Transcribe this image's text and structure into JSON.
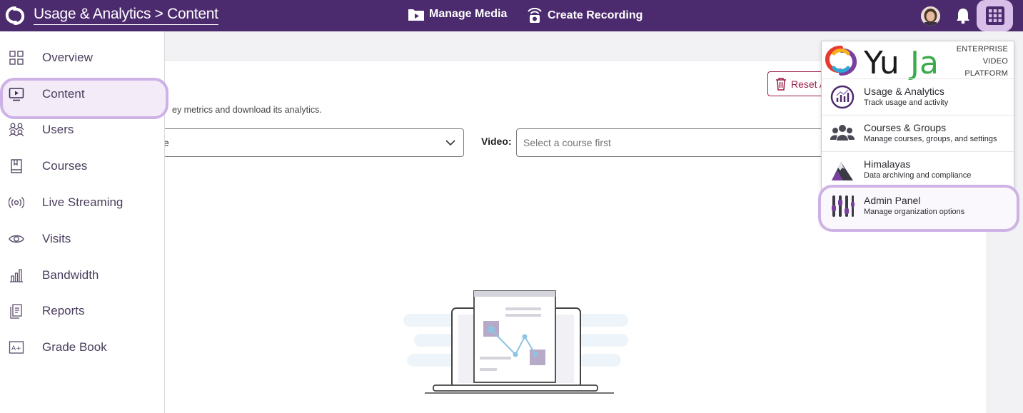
{
  "header": {
    "breadcrumb": "Usage & Analytics > Content",
    "manage_media": "Manage Media",
    "create_recording": "Create Recording",
    "icons": [
      "yuja-logo-icon",
      "media-folder-icon",
      "camera-icon",
      "avatar",
      "bell-icon",
      "apps-grid-icon"
    ]
  },
  "sidebar": {
    "items": [
      {
        "label": "Overview",
        "icon": "grid-icon"
      },
      {
        "label": "Content",
        "icon": "monitor-play-icon",
        "active": true
      },
      {
        "label": "Users",
        "icon": "users-icon"
      },
      {
        "label": "Courses",
        "icon": "book-icon"
      },
      {
        "label": "Live Streaming",
        "icon": "broadcast-icon"
      },
      {
        "label": "Visits",
        "icon": "eye-icon"
      },
      {
        "label": "Bandwidth",
        "icon": "bar-chart-icon"
      },
      {
        "label": "Reports",
        "icon": "report-icon"
      },
      {
        "label": "Grade Book",
        "icon": "grade-icon"
      }
    ]
  },
  "main": {
    "description": "ey metrics and download its analytics.",
    "reset_label": "Reset A",
    "course_value": "e",
    "video_label": "Video:",
    "video_placeholder": "Select a course first"
  },
  "apps_menu": {
    "platform_line1": "ENTERPRISE",
    "platform_line2": "VIDEO",
    "platform_line3": "PLATFORM",
    "items": [
      {
        "title": "Usage & Analytics",
        "subtitle": "Track usage and activity",
        "icon": "analytics-icon"
      },
      {
        "title": "Courses & Groups",
        "subtitle": "Manage courses, groups, and settings",
        "icon": "groups-icon"
      },
      {
        "title": "Himalayas",
        "subtitle": "Data archiving and compliance",
        "icon": "mountain-icon"
      },
      {
        "title": "Admin Panel",
        "subtitle": "Manage organization options",
        "icon": "sliders-icon",
        "active": true
      }
    ]
  },
  "colors": {
    "header": "#4c2a6e",
    "highlight": "#cdb2e6",
    "accent_red": "#9b1c4a"
  }
}
